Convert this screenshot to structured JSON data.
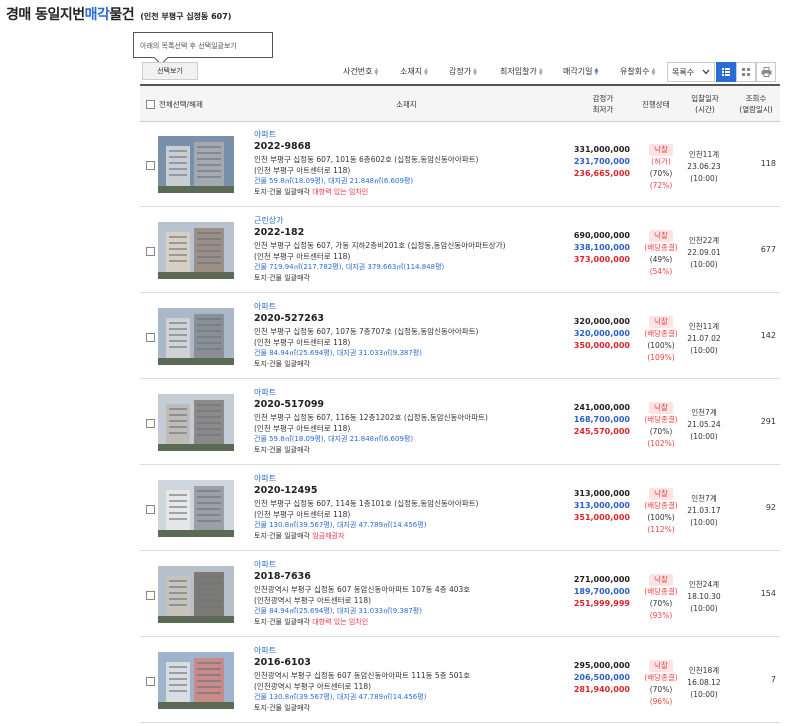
{
  "header": {
    "title_main": "경매 동일지번 ",
    "title_accent": "매각",
    "title_rest": "물건",
    "subtitle": "(인천 부평구 십정동 607)"
  },
  "tooltip": {
    "text": "아래의 목록선택 후 선택일괄보기"
  },
  "toolbar": {
    "select_view": "선택보기",
    "sort_items": [
      "사건번호",
      "소재지",
      "감정가",
      "최저입찰가",
      "매각기일",
      "유찰회수"
    ],
    "per_page": "목록수",
    "icons": [
      "list-view-icon",
      "grid-view-icon",
      "print-icon"
    ]
  },
  "table": {
    "headers": {
      "select_all": "전체선택/해제",
      "location": "소재지",
      "price_top": "감정가",
      "price_bottom": "최저가",
      "status": "진행상태",
      "date_top": "입찰일자",
      "date_bottom": "(시간)",
      "views_top": "조회수",
      "views_bottom": "(열람일시)"
    },
    "rows": [
      {
        "type": "아파트",
        "case_no": "2022-9868",
        "addr1": "인천 부평구 십정동 607, 101동 6층602호 (십정동,동암신동아아파트)",
        "addr2": "(인천 부평구 아트센터로 118)",
        "area": "건물 59.8㎡(18.09평), 대지권 21.848㎡(6.609평)",
        "note": "토지·건물 일괄매각",
        "note_red": "대항력 있는 임차인",
        "appraisal": "331,000,000",
        "minimum": "231,700,000",
        "sale": "236,665,000",
        "status": "낙찰",
        "paid": "(허가)",
        "pct1": "(70%)",
        "pct2": "(72%)",
        "court": "인천11계",
        "date": "23.06.23",
        "time": "(10:00)",
        "views": "118"
      },
      {
        "type": "근린상가",
        "case_no": "2022-182",
        "addr1": "인천 부평구 십정동 607, 가동 지하2층비201호 (십정동,동암신동아아파트상가)",
        "addr2": "(인천 부평구 아트센터로 118)",
        "area": "건물 719.94㎡(217.782평), 대지권 379.663㎡(114.848평)",
        "note": "토지·건물 일괄매각",
        "note_red": "",
        "appraisal": "690,000,000",
        "minimum": "338,100,000",
        "sale": "373,000,000",
        "status": "낙찰",
        "paid": "(배당종결)",
        "pct1": "(49%)",
        "pct2": "(54%)",
        "court": "인천22계",
        "date": "22.09.01",
        "time": "(10:00)",
        "views": "677"
      },
      {
        "type": "아파트",
        "case_no": "2020-527263",
        "addr1": "인천 부평구 십정동 607, 107동 7층707호 (십정동,동암신동아아파트)",
        "addr2": "(인천 부평구 아트센터로 118)",
        "area": "건물 84.94㎡(25.694평), 대지권 31.033㎡(9.387평)",
        "note": "토지·건물 일괄매각",
        "note_red": "",
        "appraisal": "320,000,000",
        "minimum": "320,000,000",
        "sale": "350,000,000",
        "status": "낙찰",
        "paid": "(배당종결)",
        "pct1": "(100%)",
        "pct2": "(109%)",
        "court": "인천11계",
        "date": "21.07.02",
        "time": "(10:00)",
        "views": "142"
      },
      {
        "type": "아파트",
        "case_no": "2020-517099",
        "addr1": "인천 부평구 십정동 607, 116동 12층1202호 (십정동,동암신동아아파트)",
        "addr2": "(인천 부평구 아트센터로 118)",
        "area": "건물 59.8㎡(18.09평), 대지권 21.848㎡(6.609평)",
        "note": "토지·건물 일괄매각",
        "note_red": "",
        "appraisal": "241,000,000",
        "minimum": "168,700,000",
        "sale": "245,570,000",
        "status": "낙찰",
        "paid": "(배당종결)",
        "pct1": "(70%)",
        "pct2": "(102%)",
        "court": "인천7계",
        "date": "21.05.24",
        "time": "(10:00)",
        "views": "291"
      },
      {
        "type": "아파트",
        "case_no": "2020-12495",
        "addr1": "인천 부평구 십정동 607, 114동 1층101호 (십정동,동암신동아아파트)",
        "addr2": "(인천 부평구 아트센터로 118)",
        "area": "건물 130.8㎡(39.567평), 대지권 47.789㎡(14.456평)",
        "note": "토지·건물 일괄매각",
        "note_red": "임금채권자",
        "appraisal": "313,000,000",
        "minimum": "313,000,000",
        "sale": "351,000,000",
        "status": "낙찰",
        "paid": "(배당종결)",
        "pct1": "(100%)",
        "pct2": "(112%)",
        "court": "인천7계",
        "date": "21.03.17",
        "time": "(10:00)",
        "views": "92"
      },
      {
        "type": "아파트",
        "case_no": "2018-7636",
        "addr1": "인천광역시 부평구 십정동 607 동암신동아아파트 107동 4층 403호",
        "addr2": "(인천광역시 부평구 아트센터로 118)",
        "area": "건물 84.94㎡(25.694평), 대지권 31.033㎡(9.387평)",
        "note": "토지·건물 일괄매각",
        "note_red": "대항력 있는 임차인",
        "appraisal": "271,000,000",
        "minimum": "189,700,000",
        "sale": "251,999,999",
        "status": "낙찰",
        "paid": "(배당종결)",
        "pct1": "(70%)",
        "pct2": "(93%)",
        "court": "인천24계",
        "date": "18.10.30",
        "time": "(10:00)",
        "views": "154"
      },
      {
        "type": "아파트",
        "case_no": "2016-6103",
        "addr1": "인천광역시 부평구 십정동 607 동암신동아아파트 111동 5층 501호",
        "addr2": "(인천광역시 부평구 아트센터로 118)",
        "area": "건물 130.8㎡(39.567평), 대지권 47.789㎡(14.456평)",
        "note": "토지·건물 일괄매각",
        "note_red": "",
        "appraisal": "295,000,000",
        "minimum": "206,500,000",
        "sale": "281,940,000",
        "status": "낙찰",
        "paid": "(배당종결)",
        "pct1": "(70%)",
        "pct2": "(96%)",
        "court": "인천18계",
        "date": "16.08.12",
        "time": "(10:00)",
        "views": "7"
      }
    ]
  }
}
